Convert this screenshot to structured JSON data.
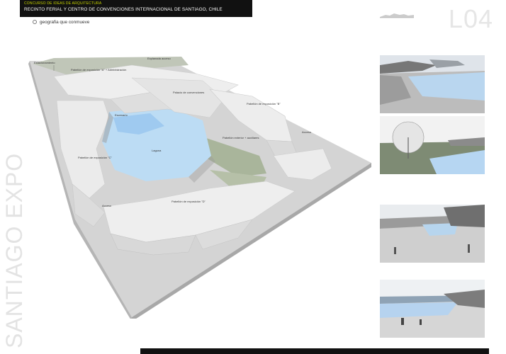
{
  "header": {
    "kicker": "CONCURSO DE IDEAS DE ARQUITECTURA",
    "title": "RECINTO FERIAL Y CENTRO DE CONVENCIONES INTERNACIONAL DE SANTIAGO, CHILE",
    "sheet_number": "L04"
  },
  "subtitle": "geografia que conmueve",
  "side_title": "SANTIAGO EXPO",
  "plan_labels": {
    "estacionamiento": "Estacionamiento",
    "explanada": "Explanada acceso",
    "pabellon_a": "Pabellón de exposición \"A\" + Administración",
    "pabellon_b": "Pabellón de exposición \"B\"",
    "pabellon_c": "Pabellón de exposición \"C\"",
    "pabellon_d": "Pabellón de exposición \"D\"",
    "palacio": "Palacio de convenciones",
    "escenario": "Escenario",
    "laguna": "Laguna",
    "pabellon_exterior": "Pabellón exterior + auxiliares",
    "acceso_right": "Acceso",
    "acceso_left": "Acceso"
  },
  "colors": {
    "water": "#bcdcf4",
    "green": "#a9b59b",
    "roof": "#e9e9e9",
    "ground": "#c9c9c9",
    "bar": "#111111"
  }
}
